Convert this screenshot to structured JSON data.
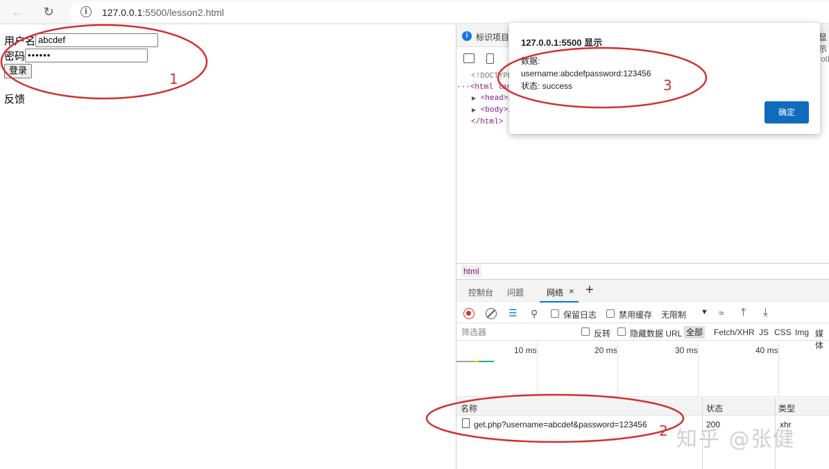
{
  "browser": {
    "url_host": "127.0.0.1",
    "url_path": ":5500/lesson2.html"
  },
  "page": {
    "username_label": "用户名",
    "username_value": "abcdef",
    "password_label": "密码",
    "password_value": "••••••",
    "login_button": "登录",
    "feedback_text": "反馈"
  },
  "devtools": {
    "infobar_text": "标识项目",
    "infobar_right": "显示",
    "tools_overflow": "othe",
    "dom": {
      "doctype": "<!DOCTYPE",
      "html_open": "<html lan",
      "head": "<head>…",
      "body": "<body>…",
      "html_close": "</html>"
    },
    "breadcrumb": "html",
    "tabs": [
      "控制台",
      "问题",
      "网络"
    ],
    "tab_close": "×",
    "network_toolbar": {
      "preserve_log": "保留日志",
      "disable_cache": "禁用缓存",
      "throttle": "无限制"
    },
    "filter": {
      "placeholder": "筛选器",
      "invert": "反转",
      "hide_data_urls": "隐藏数据 URL",
      "all": "全部",
      "types": [
        "Fetch/XHR",
        "JS",
        "CSS",
        "Img",
        "媒体"
      ]
    },
    "timeline_ticks": [
      "10 ms",
      "20 ms",
      "30 ms",
      "40 ms"
    ],
    "columns": [
      "名称",
      "状态",
      "类型"
    ],
    "requests": [
      {
        "name": "get.php?username=abcdef&password=123456",
        "status": "200",
        "type": "xhr"
      }
    ]
  },
  "dialog": {
    "title": "127.0.0.1:5500 显示",
    "line1": "数据:",
    "line2": "username:abcdefpassword:123456",
    "line3": "状态: success",
    "ok_button": "确定"
  },
  "annotations": {
    "n1": "1",
    "n2": "2",
    "n3": "3",
    "color": "#d32f2f"
  },
  "watermark": "知乎 @张健",
  "colors": {
    "accent": "#0078d4",
    "dialog_button": "#0f6cbd",
    "record_red": "#d93025",
    "dom_tag": "#881280"
  }
}
